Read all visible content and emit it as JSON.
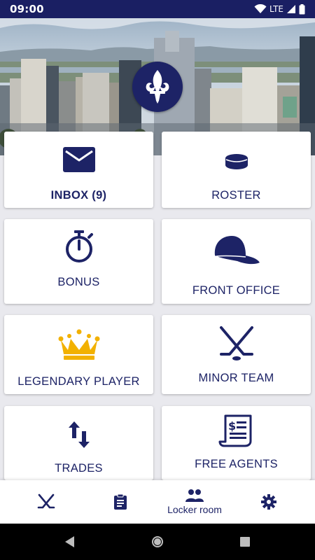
{
  "status_bar": {
    "time": "09:00",
    "network": "LTE"
  },
  "colors": {
    "navy": "#1d2366",
    "gold": "#f2b100",
    "status_bg": "#1a1f63"
  },
  "hero": {
    "logo_icon": "fleur-de-lis-icon"
  },
  "tiles": [
    {
      "id": "inbox",
      "label": "INBOX (9)",
      "icon": "envelope-icon"
    },
    {
      "id": "roster",
      "label": "ROSTER",
      "icon": "hockey-puck-icon"
    },
    {
      "id": "bonus",
      "label": "BONUS",
      "icon": "stopwatch-icon"
    },
    {
      "id": "front-office",
      "label": "FRONT OFFICE",
      "icon": "cap-icon"
    },
    {
      "id": "legendary-player",
      "label": "LEGENDARY PLAYER",
      "icon": "crown-icon"
    },
    {
      "id": "minor-team",
      "label": "MINOR TEAM",
      "icon": "crossed-hockey-sticks-icon"
    },
    {
      "id": "trades",
      "label": "TRADES",
      "icon": "swap-arrows-icon"
    },
    {
      "id": "free-agents",
      "label": "FREE AGENTS",
      "icon": "contract-scroll-icon"
    }
  ],
  "bottom_nav": {
    "items": [
      {
        "icon": "hockey-sticks-icon",
        "label": ""
      },
      {
        "icon": "clipboard-icon",
        "label": ""
      },
      {
        "icon": "people-icon",
        "label": "Locker room",
        "active": true
      },
      {
        "icon": "gear-icon",
        "label": ""
      }
    ]
  },
  "system_nav": {
    "back": "back-icon",
    "home": "home-icon",
    "recents": "recents-icon"
  }
}
